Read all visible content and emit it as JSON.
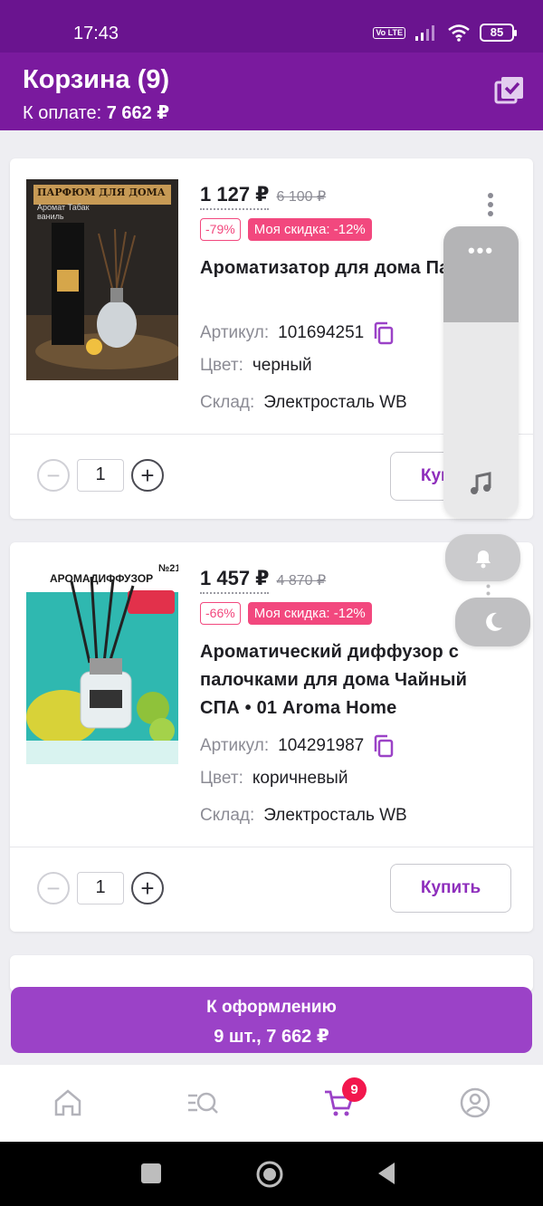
{
  "status_bar": {
    "time": "17:43",
    "network_label": "Vo LTE",
    "battery": "85"
  },
  "header": {
    "title": "Корзина (9)",
    "pay_label": "К оплате:",
    "pay_amount": "7 662 ₽",
    "select_all_icon": "checkbox-stack-icon"
  },
  "cart_items": [
    {
      "thumb_title": "ПАРФЮМ ДЛЯ ДОМА",
      "thumb_sub": "Аромат Табак ваниль",
      "price": "1 127 ₽",
      "old_price": "6 100 ₽",
      "discount": "-79%",
      "my_discount": "Моя скидка: -12%",
      "name": "Ароматизатор для дома Парфюм для дома • DEY&",
      "article_label": "Артикул:",
      "article": "101694251",
      "color_label": "Цвет:",
      "color": "черный",
      "warehouse_label": "Склад:",
      "warehouse": "Электросталь WB",
      "qty": "1",
      "buy_label": "Купить"
    },
    {
      "thumb_title": "АРОМАДИФФУЗОР",
      "thumb_sub": "№21",
      "price": "1 457 ₽",
      "old_price": "4 870 ₽",
      "discount": "-66%",
      "my_discount": "Моя скидка: -12%",
      "name": "Ароматический диффузор с палочками для дома Чайный СПА • 01 Aroma Home",
      "article_label": "Артикул:",
      "article": "104291987",
      "color_label": "Цвет:",
      "color": "коричневый",
      "warehouse_label": "Склад:",
      "warehouse": "Электросталь WB",
      "qty": "1",
      "buy_label": "Купить"
    }
  ],
  "checkout": {
    "label": "К оформлению",
    "summary": "9 шт., 7 662 ₽"
  },
  "tabbar": {
    "tabs": [
      "home-icon",
      "catalog-search-icon",
      "cart-icon",
      "profile-icon"
    ],
    "cart_count": "9"
  },
  "overlay": {
    "volume_level": 0.33,
    "icons": [
      "more-icon",
      "music-note-icon",
      "bell-icon",
      "moon-icon"
    ]
  },
  "colors": {
    "brand": "#7a1a9e",
    "accent": "#9b42c7",
    "pink": "#f2487e"
  }
}
